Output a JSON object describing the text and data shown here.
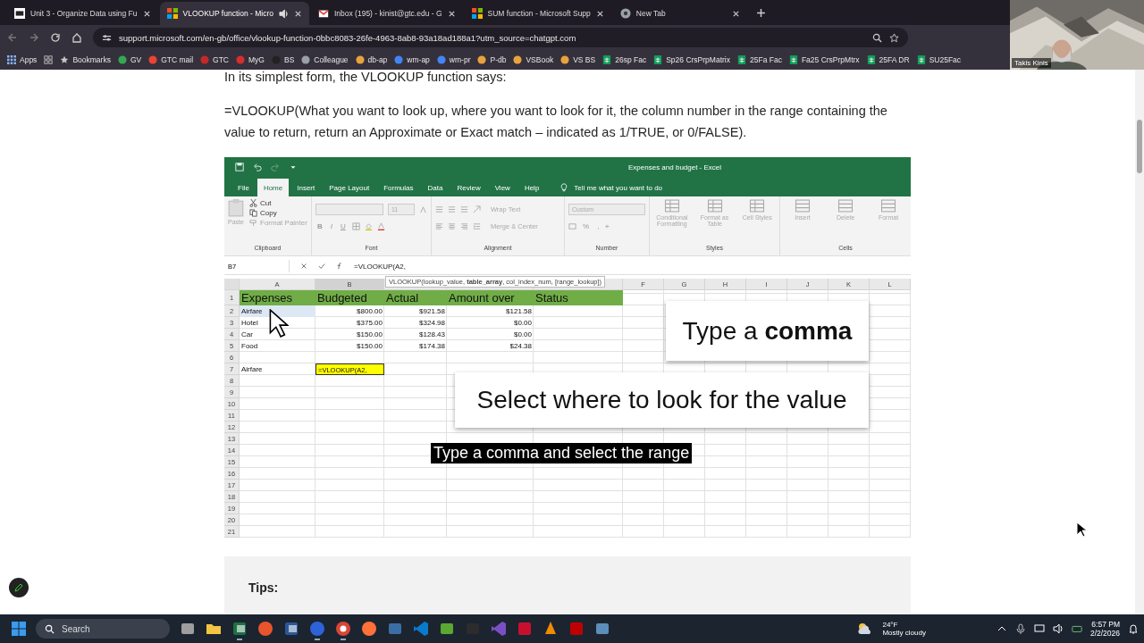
{
  "browser": {
    "tabs": [
      {
        "title": "Unit 3 - Organize Data using Fu",
        "kind": "d2l",
        "selected": false,
        "audio": false
      },
      {
        "title": "VLOOKUP function - Micro",
        "kind": "microsoft",
        "selected": true,
        "audio": true
      },
      {
        "title": "Inbox (195) - kinist@gtc.edu - G",
        "kind": "gmail",
        "selected": false,
        "audio": false
      },
      {
        "title": "SUM function - Microsoft Supp",
        "kind": "microsoft",
        "selected": false,
        "audio": false
      },
      {
        "title": "New Tab",
        "kind": "chrome",
        "selected": false,
        "audio": false
      }
    ],
    "url": "support.microsoft.com/en-gb/office/vlookup-function-0bbc8083-26fe-4963-8ab8-93a18ad188a1?utm_source=chatgpt.com",
    "bookmarks": [
      {
        "label": "Apps",
        "kind": "apps",
        "color": "#8ab4f8"
      },
      {
        "label": "Bookmarks",
        "kind": "star",
        "color": "#c4c7c5"
      },
      {
        "label": "GV",
        "kind": "site",
        "color": "#34a853"
      },
      {
        "label": "GTC mail",
        "kind": "site",
        "color": "#ea4335"
      },
      {
        "label": "GTC",
        "kind": "site",
        "color": "#c62828"
      },
      {
        "label": "MyG",
        "kind": "site",
        "color": "#d32f2f"
      },
      {
        "label": "BS",
        "kind": "site",
        "color": "#222222"
      },
      {
        "label": "Colleague",
        "kind": "site",
        "color": "#9aa0a6"
      },
      {
        "label": "db-ap",
        "kind": "site",
        "color": "#e8a33d"
      },
      {
        "label": "wm-ap",
        "kind": "site",
        "color": "#4285f4"
      },
      {
        "label": "wm-pr",
        "kind": "site",
        "color": "#4285f4"
      },
      {
        "label": "P-db",
        "kind": "site",
        "color": "#e8a33d"
      },
      {
        "label": "VSBook",
        "kind": "site",
        "color": "#e8a33d"
      },
      {
        "label": "VS BS",
        "kind": "site",
        "color": "#e8a33d"
      },
      {
        "label": "26sp Fac",
        "kind": "sheet",
        "color": "#0f9d58"
      },
      {
        "label": "Sp26 CrsPrpMatrix",
        "kind": "sheet",
        "color": "#0f9d58"
      },
      {
        "label": "25Fa Fac",
        "kind": "sheet",
        "color": "#0f9d58"
      },
      {
        "label": "Fa25 CrsPrpMtrx",
        "kind": "sheet",
        "color": "#0f9d58"
      },
      {
        "label": "25FA DR",
        "kind": "sheet",
        "color": "#0f9d58"
      },
      {
        "label": "SU25Fac",
        "kind": "sheet",
        "color": "#0f9d58"
      }
    ]
  },
  "webcam": {
    "name": "Takis Kinis",
    "kind": "picture"
  },
  "page": {
    "intro": "In its simplest form, the VLOOKUP function says:",
    "syntax": "=VLOOKUP(What you want to look up, where you want to look for it, the column number in the range containing the value to return, return an Approximate or Exact match – indicated as 1/TRUE, or 0/FALSE).",
    "tips_heading": "Tips:"
  },
  "excel": {
    "title": "Expenses and budget  -  Excel",
    "ribbon_tabs": [
      {
        "label": "File",
        "selected": false
      },
      {
        "label": "Home",
        "selected": true
      },
      {
        "label": "Insert",
        "selected": false
      },
      {
        "label": "Page Layout",
        "selected": false
      },
      {
        "label": "Formulas",
        "selected": false
      },
      {
        "label": "Data",
        "selected": false
      },
      {
        "label": "Review",
        "selected": false
      },
      {
        "label": "View",
        "selected": false
      },
      {
        "label": "Help",
        "selected": false
      }
    ],
    "tell_me": "Tell me what you want to do",
    "clipboard": {
      "label": "Clipboard",
      "paste": {
        "label": "Paste",
        "disabled": true
      },
      "commands": [
        {
          "label": "Cut",
          "kind": "cut",
          "disabled": false
        },
        {
          "label": "Copy",
          "kind": "copy",
          "disabled": false
        },
        {
          "label": "Format Painter",
          "kind": "painter",
          "disabled": true
        }
      ]
    },
    "font": {
      "label": "Font",
      "size": "11",
      "buttons": [
        "B",
        "I",
        "U"
      ]
    },
    "alignment": {
      "label": "Alignment",
      "wrap": "Wrap Text",
      "merge": "Merge & Center"
    },
    "number": {
      "label": "Number",
      "format": "Custom",
      "buttons": [
        "%",
        ","
      ]
    },
    "styles": {
      "label": "Styles",
      "commands": [
        "Conditional Formatting",
        "Format as Table",
        "Cell Styles"
      ]
    },
    "cells": {
      "label": "Cells",
      "commands": [
        "Insert",
        "Delete",
        "Format"
      ]
    },
    "name_box": "B7",
    "formula": "=VLOOKUP(A2,",
    "tooltip": "VLOOKUP(lookup_value, **table_array**, col_index_num, [range_lookup])",
    "columns": [
      {
        "label": "A",
        "selected": false
      },
      {
        "label": "B",
        "selected": true
      },
      {
        "selected": false
      },
      {
        "selected": false
      },
      {
        "selected": false
      },
      {
        "label": "F",
        "selected": false
      },
      {
        "label": "G",
        "selected": false
      },
      {
        "label": "H",
        "selected": false
      },
      {
        "label": "I",
        "selected": false
      },
      {
        "label": "J",
        "selected": false
      },
      {
        "label": "K",
        "selected": false
      },
      {
        "label": "L",
        "selected": false
      }
    ],
    "rows": [
      {
        "label": "1",
        "cells": [
          {
            "text": "Expenses",
            "kind": "heading"
          },
          {
            "text": "Budgeted",
            "kind": "heading"
          },
          {
            "text": "Actual",
            "kind": "heading"
          },
          {
            "text": "Amount over",
            "kind": "heading"
          },
          {
            "text": "Status",
            "kind": "heading"
          }
        ]
      },
      {
        "label": "2",
        "cells": [
          {
            "text": "Airfare",
            "kind": "reference"
          },
          {
            "text": "$800.00",
            "kind": "number"
          },
          {
            "text": "$921.58",
            "kind": "number"
          },
          {
            "text": "$121.58",
            "kind": "number"
          }
        ]
      },
      {
        "label": "3",
        "cells": [
          {
            "text": "Hotel",
            "kind": "text"
          },
          {
            "text": "$375.00",
            "kind": "number"
          },
          {
            "text": "$324.98",
            "kind": "number"
          },
          {
            "text": "$0.00",
            "kind": "number"
          }
        ]
      },
      {
        "label": "4",
        "cells": [
          {
            "text": "Car",
            "kind": "text"
          },
          {
            "text": "$150.00",
            "kind": "number"
          },
          {
            "text": "$128.43",
            "kind": "number"
          },
          {
            "text": "$0.00",
            "kind": "number"
          }
        ]
      },
      {
        "label": "5",
        "cells": [
          {
            "text": "Food",
            "kind": "text"
          },
          {
            "text": "$150.00",
            "kind": "number"
          },
          {
            "text": "$174.38",
            "kind": "number"
          },
          {
            "text": "$24.38",
            "kind": "number"
          }
        ]
      },
      {
        "label": "6"
      },
      {
        "label": "7",
        "cells": [
          {
            "text": "Airfare",
            "kind": "text"
          },
          {
            "text": "=VLOOKUP(A2,",
            "kind": "editing"
          }
        ]
      },
      {
        "label": "8"
      },
      {
        "label": "9"
      },
      {
        "label": "10"
      },
      {
        "label": "11"
      },
      {
        "label": "12"
      },
      {
        "label": "13"
      },
      {
        "label": "14"
      },
      {
        "label": "15"
      },
      {
        "label": "16"
      },
      {
        "label": "17"
      },
      {
        "label": "18"
      },
      {
        "label": "19"
      },
      {
        "label": "20"
      },
      {
        "label": "21"
      }
    ],
    "callouts": [
      "Type a **comma**",
      "Select where to look for the value"
    ],
    "caption": "Type a comma and select the range"
  },
  "taskbar": {
    "search": "Search",
    "apps": [
      {
        "kind": "taskview",
        "color": "#9e9e9e",
        "running": false
      },
      {
        "kind": "folder",
        "color": "#f4c542",
        "running": false
      },
      {
        "kind": "excel",
        "color": "#1d7044",
        "running": true
      },
      {
        "kind": "photos",
        "color": "#e8542c",
        "running": false
      },
      {
        "kind": "word",
        "color": "#2b5797",
        "running": false
      },
      {
        "kind": "zoom",
        "color": "#2d63d8",
        "running": true
      },
      {
        "kind": "chrome",
        "color": "#db4437",
        "running": true
      },
      {
        "kind": "firefox",
        "color": "#ff7139",
        "running": false
      },
      {
        "kind": "tool",
        "color": "#3b6ea5",
        "running": false
      },
      {
        "kind": "vscode",
        "color": "#0a7acc",
        "running": false
      },
      {
        "kind": "notepad",
        "color": "#5aa832",
        "running": false
      },
      {
        "kind": "terminal",
        "color": "#2c2c2c",
        "running": false
      },
      {
        "kind": "studio",
        "color": "#7b4fc4",
        "running": false
      },
      {
        "kind": "acrobat",
        "color": "#c8102e",
        "running": false
      },
      {
        "kind": "vlc",
        "color": "#f08c00",
        "running": false
      },
      {
        "kind": "filezilla",
        "color": "#bf0000",
        "running": false
      },
      {
        "kind": "window",
        "color": "#5b8fb9",
        "running": false
      }
    ],
    "temperature": "24°F",
    "weather": "Mostly cloudy",
    "time": "6:57 PM",
    "date": "2/2/2026"
  }
}
